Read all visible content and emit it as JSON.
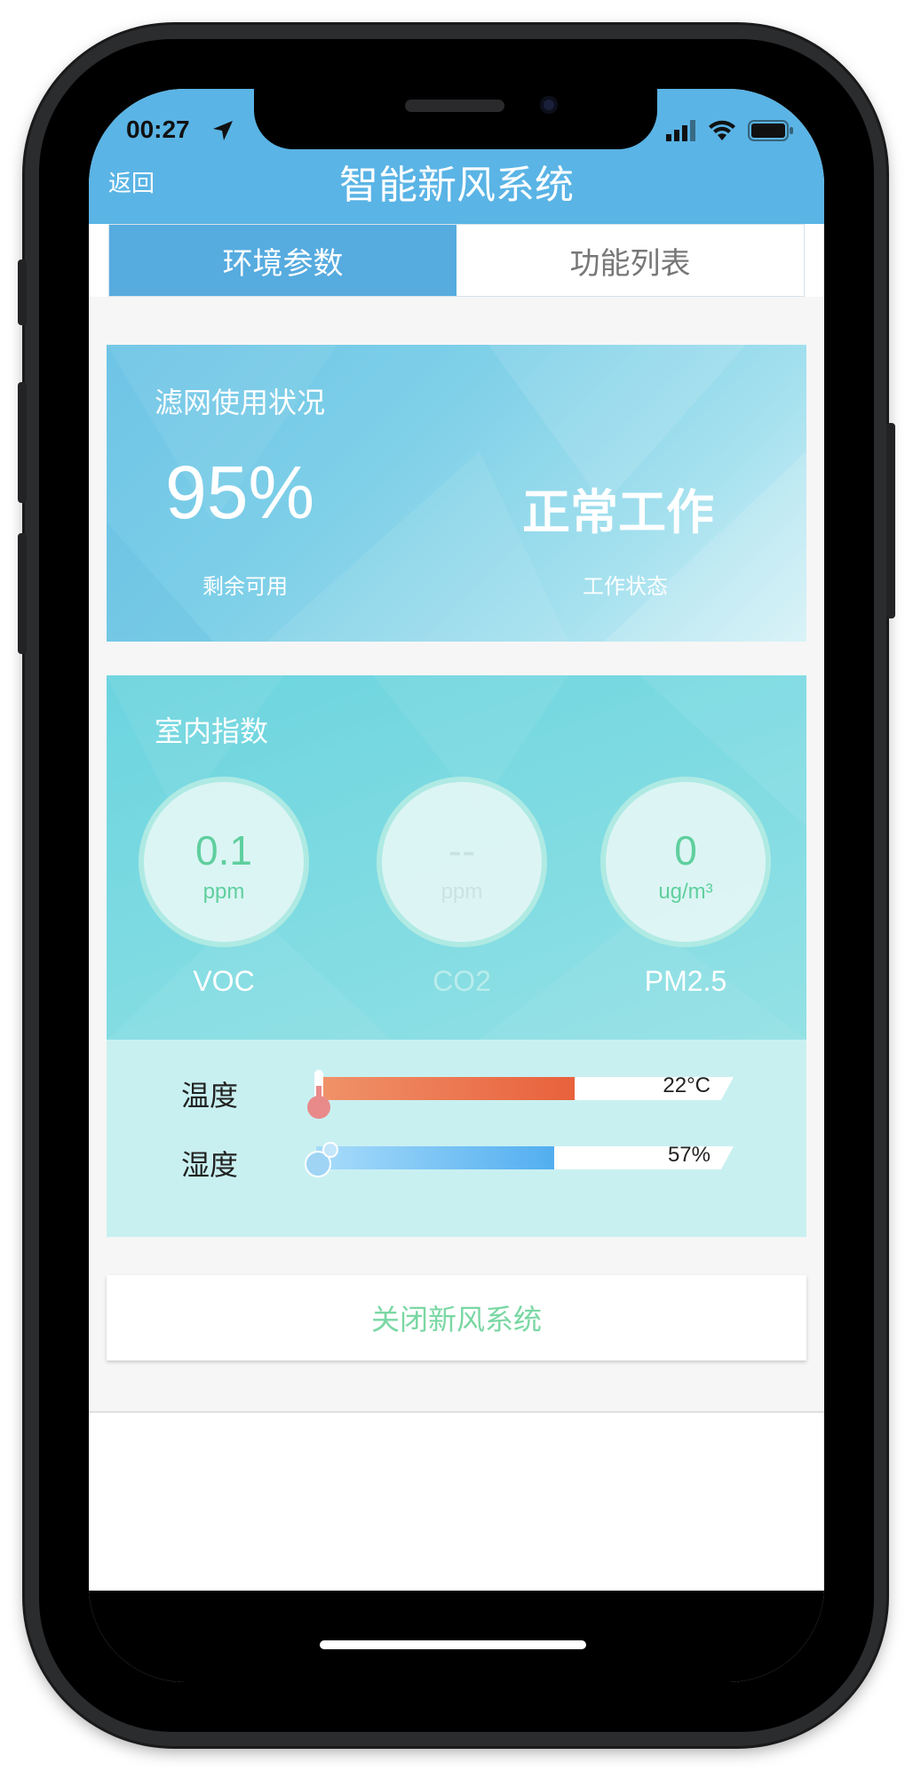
{
  "status_bar": {
    "time": "00:27",
    "icons": [
      "location-arrow-icon",
      "signal-icon",
      "wifi-icon",
      "battery-icon"
    ]
  },
  "header": {
    "back_label": "返回",
    "title": "智能新风系统",
    "color": "#5ab4e5"
  },
  "tabs": [
    {
      "label": "环境参数",
      "active": true
    },
    {
      "label": "功能列表",
      "active": false
    }
  ],
  "filter": {
    "title": "滤网使用状况",
    "remaining_value": "95%",
    "remaining_label": "剩余可用",
    "status_value": "正常工作",
    "status_label": "工作状态"
  },
  "indoor": {
    "title": "室内指数",
    "metrics": [
      {
        "name": "VOC",
        "value": "0.1",
        "unit": "ppm",
        "color": "#5fcf9e"
      },
      {
        "name": "CO2",
        "value": "--",
        "unit": "ppm",
        "color": "#c9e4e0"
      },
      {
        "name": "PM2.5",
        "value": "0",
        "unit": "ug/m³",
        "color": "#5fcf9e"
      }
    ]
  },
  "climate": {
    "temperature": {
      "label": "温度",
      "value": "22°C",
      "level": 0.62,
      "color": "#e8613c"
    },
    "humidity": {
      "label": "湿度",
      "value": "57%",
      "level": 0.57,
      "color": "#52aef0"
    }
  },
  "action": {
    "close_label": "关闭新风系统",
    "color": "#7ad7a3"
  }
}
